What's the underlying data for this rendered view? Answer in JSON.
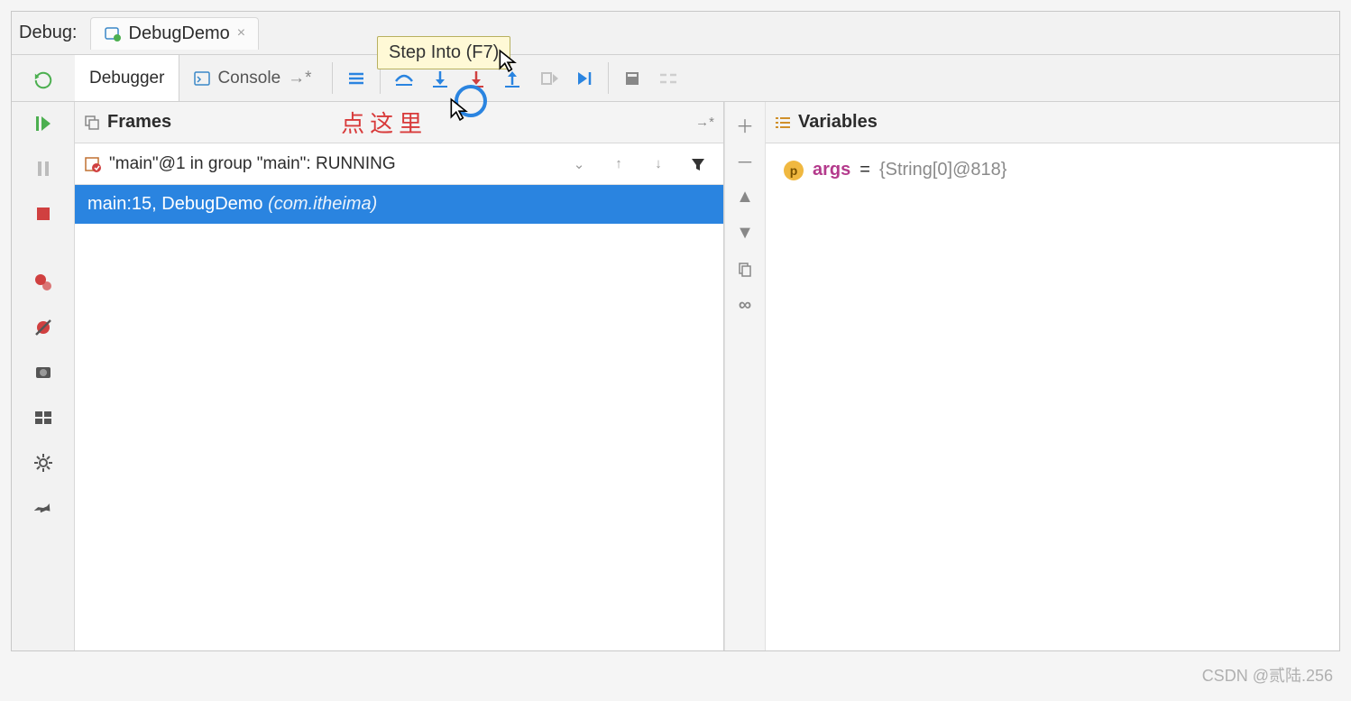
{
  "header": {
    "section_label": "Debug:",
    "run_config": "DebugDemo",
    "tooltip": "Step Into (F7)"
  },
  "tabs": {
    "debugger": "Debugger",
    "console": "Console"
  },
  "frames": {
    "title": "Frames",
    "annotation": "点这里",
    "thread": "\"main\"@1 in group \"main\": RUNNING",
    "stack": [
      {
        "loc": "main:15, DebugDemo",
        "pkg": "(com.itheima)"
      }
    ]
  },
  "variables": {
    "title": "Variables",
    "items": [
      {
        "badge": "p",
        "name": "args",
        "eq": "=",
        "value": "{String[0]@818}"
      }
    ]
  },
  "icons": {
    "rerun": "↻",
    "resume": "▶",
    "pause": "‖",
    "stop": "■",
    "breakpoints": "●",
    "mute": "✕",
    "camera": "📷",
    "layout": "▦",
    "settings": "⚙",
    "pin": "📌"
  },
  "watermark": "CSDN @贰陆.256"
}
